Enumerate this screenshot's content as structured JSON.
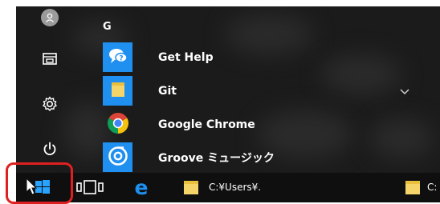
{
  "start_menu": {
    "section_letter": "G",
    "apps": [
      {
        "label": "Get Help",
        "icon": "get-help-icon",
        "tile_color": "#1f8ff0"
      },
      {
        "label": "Git",
        "icon": "folder-icon",
        "tile_color": "#1f8ff0"
      },
      {
        "label": "Google Chrome",
        "icon": "chrome-icon",
        "tile_color": "#1b1b1b"
      },
      {
        "label": "Groove ミュージック",
        "icon": "groove-music-icon",
        "tile_color": "#1f8ff0"
      }
    ],
    "rail_icons": [
      "user-icon",
      "documents-icon",
      "settings-icon",
      "power-icon"
    ]
  },
  "taskbar": {
    "items": [
      {
        "label": "",
        "icon": "windows-start-icon"
      },
      {
        "label": "",
        "icon": "task-view-icon"
      },
      {
        "label": "",
        "icon": "edge-icon"
      },
      {
        "label": "C:¥Users¥.",
        "icon": "folder-icon"
      },
      {
        "label": "C:",
        "icon": "folder-icon"
      }
    ]
  },
  "colors": {
    "accent": "#1f8ff0",
    "highlight": "#e02020",
    "menu_bg": "#1b1b1b",
    "taskbar_bg": "#0f0f0f"
  }
}
